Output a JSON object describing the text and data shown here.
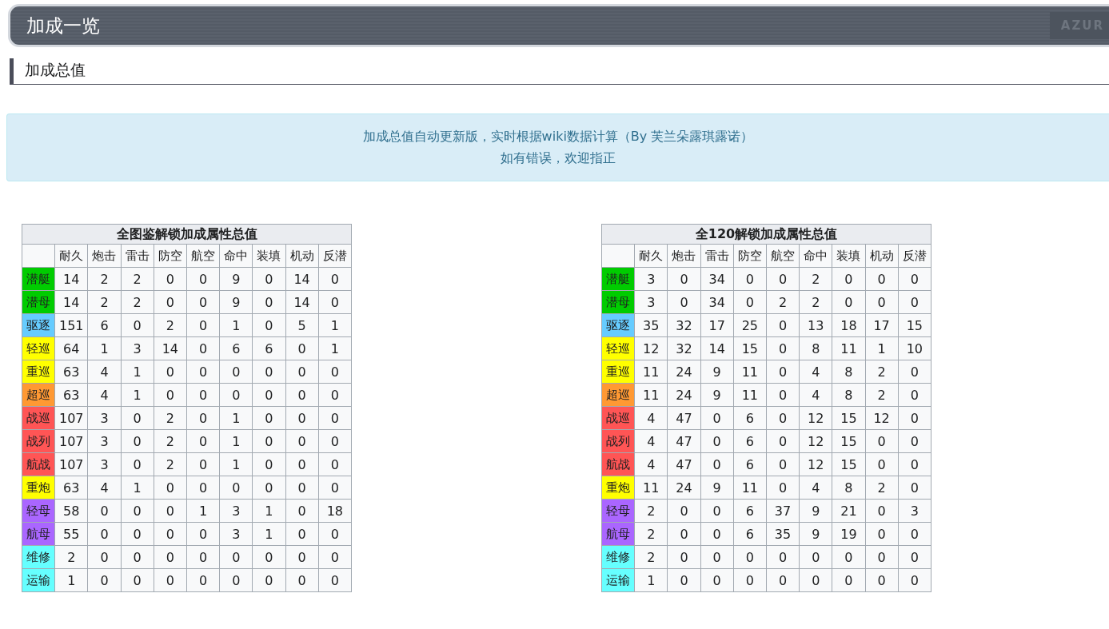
{
  "banner": {
    "title": "加成一览",
    "logo": "AZUR"
  },
  "section_heading": "加成总值",
  "notice": {
    "lines": [
      "加成总值自动更新版，实时根据wiki数据计算（By 芙兰朵露琪露诺）",
      "如有错误，欢迎指正"
    ]
  },
  "tables": [
    {
      "title": "全图鉴解锁加成属性总值",
      "columns": [
        "耐久",
        "炮击",
        "雷击",
        "防空",
        "航空",
        "命中",
        "装填",
        "机动",
        "反潜"
      ],
      "rows": [
        {
          "label": "潜艇",
          "color": "#00cc00",
          "values": [
            "14",
            "2",
            "2",
            "0",
            "0",
            "9",
            "0",
            "14",
            "0"
          ]
        },
        {
          "label": "潜母",
          "color": "#00cc00",
          "values": [
            "14",
            "2",
            "2",
            "0",
            "0",
            "9",
            "0",
            "14",
            "0"
          ]
        },
        {
          "label": "驱逐",
          "color": "#66ccff",
          "values": [
            "151",
            "6",
            "0",
            "2",
            "0",
            "1",
            "0",
            "5",
            "1"
          ]
        },
        {
          "label": "轻巡",
          "color": "#ffff00",
          "values": [
            "64",
            "1",
            "3",
            "14",
            "0",
            "6",
            "6",
            "0",
            "1"
          ]
        },
        {
          "label": "重巡",
          "color": "#ffff00",
          "values": [
            "63",
            "4",
            "1",
            "0",
            "0",
            "0",
            "0",
            "0",
            "0"
          ]
        },
        {
          "label": "超巡",
          "color": "#ff9933",
          "values": [
            "63",
            "4",
            "1",
            "0",
            "0",
            "0",
            "0",
            "0",
            "0"
          ]
        },
        {
          "label": "战巡",
          "color": "#ff5555",
          "values": [
            "107",
            "3",
            "0",
            "2",
            "0",
            "1",
            "0",
            "0",
            "0"
          ]
        },
        {
          "label": "战列",
          "color": "#ff5555",
          "values": [
            "107",
            "3",
            "0",
            "2",
            "0",
            "1",
            "0",
            "0",
            "0"
          ]
        },
        {
          "label": "航战",
          "color": "#ff5555",
          "values": [
            "107",
            "3",
            "0",
            "2",
            "0",
            "1",
            "0",
            "0",
            "0"
          ]
        },
        {
          "label": "重炮",
          "color": "#ffff00",
          "values": [
            "63",
            "4",
            "1",
            "0",
            "0",
            "0",
            "0",
            "0",
            "0"
          ]
        },
        {
          "label": "轻母",
          "color": "#aa66ff",
          "values": [
            "58",
            "0",
            "0",
            "0",
            "1",
            "3",
            "1",
            "0",
            "18"
          ]
        },
        {
          "label": "航母",
          "color": "#aa66ff",
          "values": [
            "55",
            "0",
            "0",
            "0",
            "0",
            "3",
            "1",
            "0",
            "0"
          ]
        },
        {
          "label": "维修",
          "color": "#66ffff",
          "values": [
            "2",
            "0",
            "0",
            "0",
            "0",
            "0",
            "0",
            "0",
            "0"
          ]
        },
        {
          "label": "运输",
          "color": "#66ffff",
          "values": [
            "1",
            "0",
            "0",
            "0",
            "0",
            "0",
            "0",
            "0",
            "0"
          ]
        }
      ]
    },
    {
      "title": "全120解锁加成属性总值",
      "columns": [
        "耐久",
        "炮击",
        "雷击",
        "防空",
        "航空",
        "命中",
        "装填",
        "机动",
        "反潜"
      ],
      "rows": [
        {
          "label": "潜艇",
          "color": "#00cc00",
          "values": [
            "3",
            "0",
            "34",
            "0",
            "0",
            "2",
            "0",
            "0",
            "0"
          ]
        },
        {
          "label": "潜母",
          "color": "#00cc00",
          "values": [
            "3",
            "0",
            "34",
            "0",
            "2",
            "2",
            "0",
            "0",
            "0"
          ]
        },
        {
          "label": "驱逐",
          "color": "#66ccff",
          "values": [
            "35",
            "32",
            "17",
            "25",
            "0",
            "13",
            "18",
            "17",
            "15"
          ]
        },
        {
          "label": "轻巡",
          "color": "#ffff00",
          "values": [
            "12",
            "32",
            "14",
            "15",
            "0",
            "8",
            "11",
            "1",
            "10"
          ]
        },
        {
          "label": "重巡",
          "color": "#ffff00",
          "values": [
            "11",
            "24",
            "9",
            "11",
            "0",
            "4",
            "8",
            "2",
            "0"
          ]
        },
        {
          "label": "超巡",
          "color": "#ff9933",
          "values": [
            "11",
            "24",
            "9",
            "11",
            "0",
            "4",
            "8",
            "2",
            "0"
          ]
        },
        {
          "label": "战巡",
          "color": "#ff5555",
          "values": [
            "4",
            "47",
            "0",
            "6",
            "0",
            "12",
            "15",
            "12",
            "0"
          ]
        },
        {
          "label": "战列",
          "color": "#ff5555",
          "values": [
            "4",
            "47",
            "0",
            "6",
            "0",
            "12",
            "15",
            "0",
            "0"
          ]
        },
        {
          "label": "航战",
          "color": "#ff5555",
          "values": [
            "4",
            "47",
            "0",
            "6",
            "0",
            "12",
            "15",
            "0",
            "0"
          ]
        },
        {
          "label": "重炮",
          "color": "#ffff00",
          "values": [
            "11",
            "24",
            "9",
            "11",
            "0",
            "4",
            "8",
            "2",
            "0"
          ]
        },
        {
          "label": "轻母",
          "color": "#aa66ff",
          "values": [
            "2",
            "0",
            "0",
            "6",
            "37",
            "9",
            "21",
            "0",
            "3"
          ]
        },
        {
          "label": "航母",
          "color": "#aa66ff",
          "values": [
            "2",
            "0",
            "0",
            "6",
            "35",
            "9",
            "19",
            "0",
            "0"
          ]
        },
        {
          "label": "维修",
          "color": "#66ffff",
          "values": [
            "2",
            "0",
            "0",
            "0",
            "0",
            "0",
            "0",
            "0",
            "0"
          ]
        },
        {
          "label": "运输",
          "color": "#66ffff",
          "values": [
            "1",
            "0",
            "0",
            "0",
            "0",
            "0",
            "0",
            "0",
            "0"
          ]
        }
      ]
    }
  ]
}
